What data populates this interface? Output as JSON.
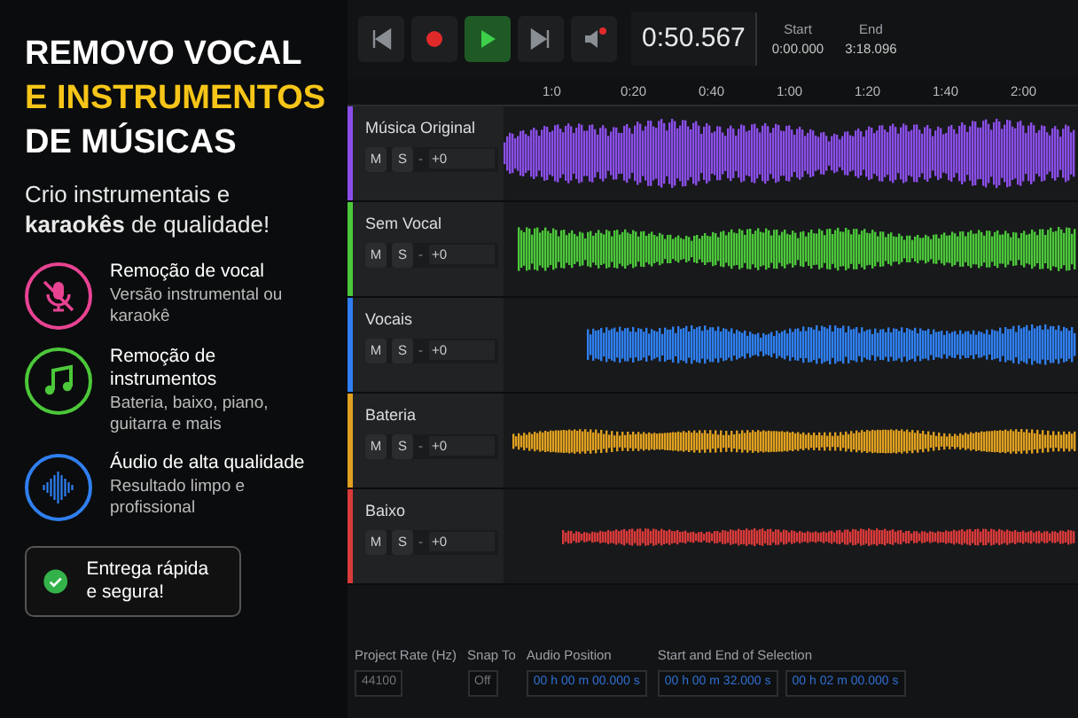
{
  "promo": {
    "headline": [
      {
        "text": "REMOVO VOCAL",
        "kind": "white"
      },
      {
        "text": "E INSTRUMENTOS",
        "kind": "accent"
      },
      {
        "text": "DE MÚSICAS",
        "kind": "white"
      }
    ],
    "subtitle": "Crio instrumentais e **karaokês** de qualidade!",
    "features": [
      {
        "kind": "mic-off",
        "color": "#e84393",
        "title": "Remoção de vocal",
        "description": "Versão instrumental ou karaokê"
      },
      {
        "kind": "note",
        "color": "#4cc83a",
        "title": "Remoção de instrumentos",
        "description": "Bateria, baixo, piano, guitarra e mais"
      },
      {
        "kind": "wave",
        "color": "#2f7ff0",
        "title": "Áudio de alta qualidade",
        "description": "Resultado limpo e profissional"
      }
    ],
    "badge": "Entrega rápida e segura!"
  },
  "transport": {
    "buttons": [
      {
        "kind": "skip-back",
        "selected": false
      },
      {
        "kind": "record",
        "selected": false
      },
      {
        "kind": "play",
        "selected": true
      },
      {
        "kind": "skip-forward",
        "selected": false
      },
      {
        "kind": "volume",
        "selected": false
      }
    ],
    "time": "0:50.567",
    "start_label": "Start",
    "start": "0:00.000",
    "end_label": "End",
    "end": "3:18.096"
  },
  "ruler": [
    "1:0",
    "0:20",
    "0:40",
    "1:00",
    "1:20",
    "1:40",
    "2:00"
  ],
  "tracks": [
    {
      "name": "Música Original",
      "color": "#8a4ee8",
      "mute": "M",
      "solo": "S",
      "separator": "-",
      "gain": "+0"
    },
    {
      "name": "Sem Vocal",
      "color": "#4cc83a",
      "mute": "M",
      "solo": "S",
      "separator": "-",
      "gain": "+0"
    },
    {
      "name": "Vocais",
      "color": "#2f7ff0",
      "mute": "M",
      "solo": "S",
      "separator": "-",
      "gain": "+0"
    },
    {
      "name": "Bateria",
      "color": "#e0a020",
      "mute": "M",
      "solo": "S",
      "separator": "-",
      "gain": "+0"
    },
    {
      "name": "Baixo",
      "color": "#d93a3a",
      "mute": "M",
      "solo": "S",
      "separator": "-",
      "gain": "+0"
    }
  ],
  "selection_bar": {
    "project_rate_label": "Project Rate (Hz)",
    "project_rate": "44100",
    "snap_label": "Snap To",
    "snap": "Off",
    "position_label": "Audio Position",
    "position": "00 h 00 m 00.000 s",
    "selection_label": "Start and End of Selection",
    "selection_start": "00 h 00 m 32.000 s",
    "selection_end": "00 h 02 m 00.000 s"
  }
}
